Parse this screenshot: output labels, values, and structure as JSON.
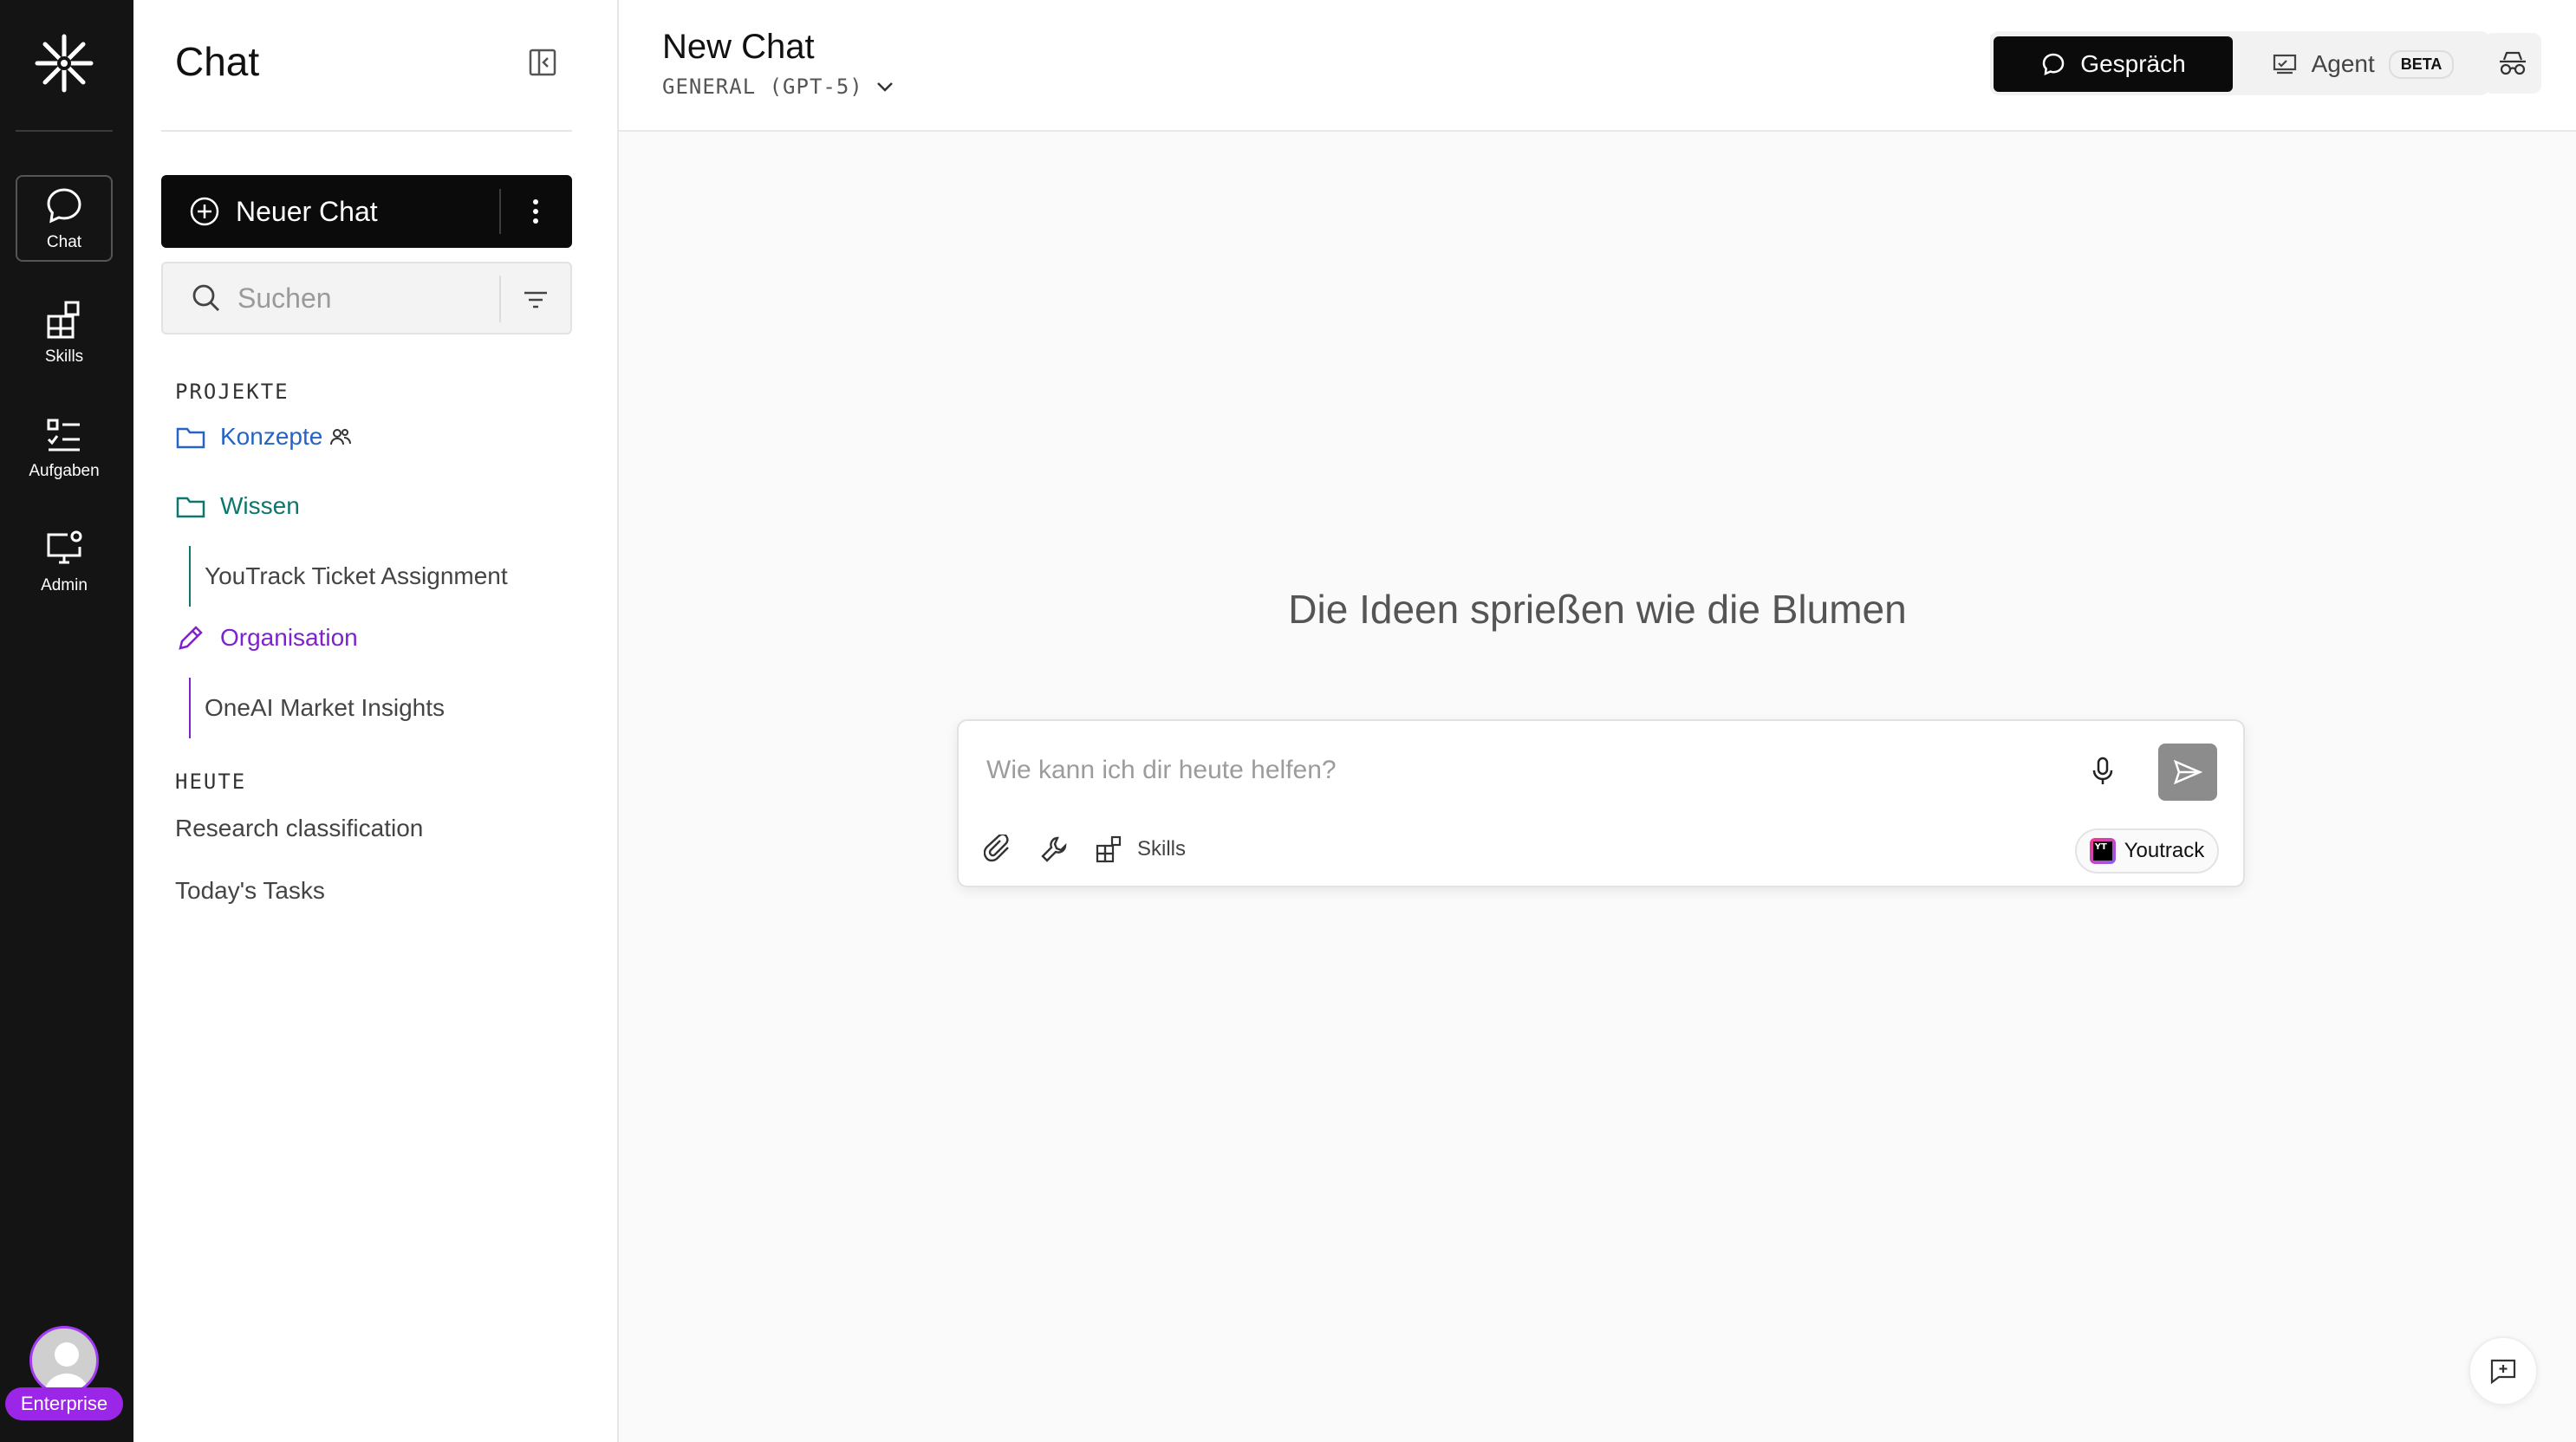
{
  "rail": {
    "items": [
      {
        "label": "Chat",
        "icon": "chat-bubble-icon",
        "active": true
      },
      {
        "label": "Skills",
        "icon": "skills-grid-icon"
      },
      {
        "label": "Aufgaben",
        "icon": "task-list-icon"
      },
      {
        "label": "Admin",
        "icon": "admin-monitor-icon"
      }
    ],
    "badge": "Enterprise"
  },
  "sidebar": {
    "title": "Chat",
    "new_chat": "Neuer Chat",
    "search_placeholder": "Suchen",
    "projects_label": "PROJEKTE",
    "projects": [
      {
        "name": "Konzepte",
        "icon": "folder-icon",
        "color": "#2563c4"
      },
      {
        "name": "Wissen",
        "icon": "folder-icon",
        "color": "#0f766e"
      },
      {
        "name": "Organisation",
        "icon": "pencil-icon",
        "color": "#7e22ce"
      }
    ],
    "project_children": {
      "wissen": "YouTrack Ticket Assignment",
      "organisation": "OneAI Market Insights"
    },
    "today_label": "HEUTE",
    "today": [
      "Research classification",
      "Today's Tasks"
    ]
  },
  "header": {
    "title": "New Chat",
    "model": "GENERAL (GPT-5)",
    "mode_conversation": "Gespräch",
    "mode_agent": "Agent",
    "beta": "BETA"
  },
  "main": {
    "hero": "Die Ideen sprießen wie die Blumen",
    "composer_placeholder": "Wie kann ich dir heute helfen?",
    "skills_label": "Skills",
    "integration_chip": "Youtrack",
    "integration_logo_text": "YT"
  },
  "colors": {
    "rail_bg": "#141414",
    "accent_purple": "#9b26e8",
    "primary_button": "#0b0b0b"
  }
}
